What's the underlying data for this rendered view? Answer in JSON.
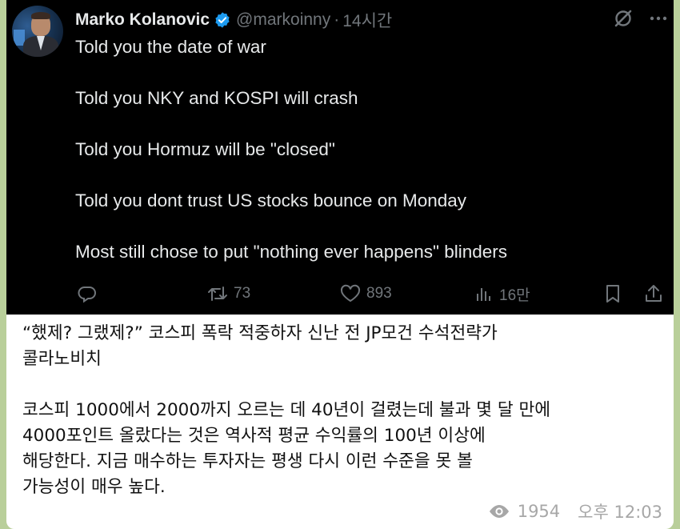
{
  "tweet": {
    "author_name": "Marko Kolanovic",
    "handle": "@markoinny",
    "separator": "·",
    "time_ago": "14시간",
    "lines": [
      "Told you the date of war",
      "Told you NKY and KOSPI will crash",
      "Told you Hormuz will be \"closed\"",
      "Told you dont trust US stocks bounce on Monday",
      "Most still chose to put \"nothing ever happens\" blinders"
    ],
    "actions": {
      "reposts": "73",
      "likes": "893",
      "views": "16만"
    }
  },
  "caption": {
    "headline_line1": "“했제? 그랬제?” 코스피 폭락 적중하자 신난 전 JP모건 수석전략가",
    "headline_line2": "콜라노비치",
    "body_line1": "코스피 1000에서 2000까지 오르는 데 40년이 걸렸는데 불과 몇 달 만에",
    "body_line2": "4000포인트 올랐다는 것은 역사적 평균 수익률의 100년 이상에",
    "body_line3": "해당한다. 지금 매수하는 투자자는 평생 다시 이런 수준을 못 볼",
    "body_line4": "가능성이 매우 높다."
  },
  "message_meta": {
    "views": "1954",
    "time": "오후 12:03"
  },
  "colors": {
    "background": "#b9cf9a",
    "tweet_bg": "#000000",
    "verified": "#1d9bf0",
    "muted": "#71767b"
  },
  "icons": [
    "verified-badge-icon",
    "grok-icon",
    "more-icon",
    "reply-icon",
    "repost-icon",
    "like-icon",
    "views-icon",
    "bookmark-icon",
    "share-icon",
    "eye-icon"
  ]
}
